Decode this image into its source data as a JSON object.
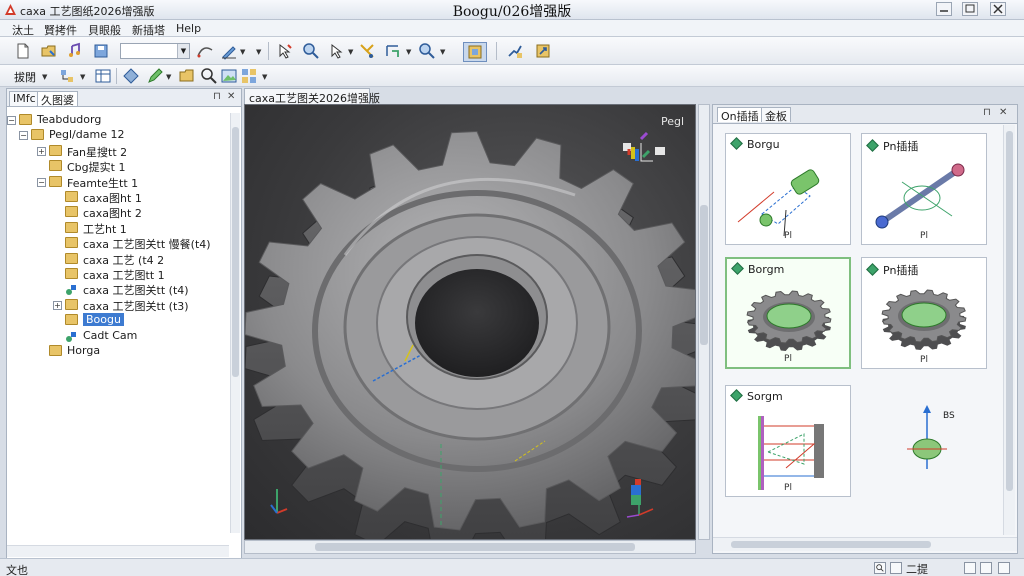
{
  "window": {
    "app_title": "caxa 工艺图纸2026增强版",
    "title": "Boogu/026增强版"
  },
  "menu": [
    "汰土",
    "賢拷件",
    "貝眼般",
    "新插塔",
    "Help"
  ],
  "toolbar2": {
    "mode_label": "拔閉"
  },
  "left_panel": {
    "tabs": [
      "IMfc",
      "久图婆"
    ],
    "tree": [
      {
        "label": "Teabdudorg",
        "level": 0,
        "type": "folder",
        "expander": "−"
      },
      {
        "label": "Pegl/dame 12",
        "level": 1,
        "type": "folder",
        "expander": "⊟"
      },
      {
        "label": "Fan星搜tt 2",
        "level": 2,
        "type": "folder",
        "expander": "⊞"
      },
      {
        "label": "Cbg提实t 1",
        "level": 2,
        "type": "folder",
        "expander": ""
      },
      {
        "label": "Feamte生tt 1",
        "level": 2,
        "type": "folder",
        "expander": "⊟"
      },
      {
        "label": "caxa图ht 1",
        "level": 3,
        "type": "folder",
        "expander": ""
      },
      {
        "label": "caxa图ht 2",
        "level": 3,
        "type": "folder",
        "expander": ""
      },
      {
        "label": "工艺ht 1",
        "level": 3,
        "type": "folder",
        "expander": ""
      },
      {
        "label": "caxa 工艺图关tt 慢餐(t4)",
        "level": 3,
        "type": "folder",
        "expander": ""
      },
      {
        "label": "caxa 工艺 (t4 2",
        "level": 3,
        "type": "folder",
        "expander": ""
      },
      {
        "label": "caxa 工艺图tt 1",
        "level": 3,
        "type": "folder",
        "expander": ""
      },
      {
        "label": "caxa 工艺图关tt (t4)",
        "level": 3,
        "type": "part",
        "expander": ""
      },
      {
        "label": "caxa 工艺图关tt (t3)",
        "level": 3,
        "type": "folder",
        "expander": "⊞"
      },
      {
        "label": "Boogu",
        "level": 3,
        "type": "folder",
        "expander": "",
        "selected": true
      },
      {
        "label": "Cadt Cam",
        "level": 3,
        "type": "part",
        "expander": ""
      },
      {
        "label": "Horga",
        "level": 2,
        "type": "folder",
        "expander": ""
      }
    ]
  },
  "viewport": {
    "tab": "caxa工艺图关2026增强版",
    "label": "Pegl"
  },
  "right_panel": {
    "tabs": [
      "On插插",
      "金板"
    ],
    "cards": [
      {
        "title": "Borgu",
        "caption": "Pl",
        "kind": "pin-green"
      },
      {
        "title": "Pn插插",
        "caption": "Pl",
        "kind": "shaft-blue"
      },
      {
        "title": "Borgm",
        "caption": "Pl",
        "kind": "gear",
        "selected": true
      },
      {
        "title": "Pn插插",
        "caption": "Pl",
        "kind": "gear"
      },
      {
        "title": "Sorgm",
        "caption": "Pl",
        "kind": "diagram"
      },
      {
        "title": "",
        "caption": "",
        "kind": "axis-dot",
        "annotation": "BS"
      }
    ]
  },
  "status": {
    "text": "文也",
    "zoom_label": "二提"
  },
  "colors": {
    "accent": "#3d7bd1",
    "gear": "#8c8c8e",
    "viewport_bg": "#3a3a3c",
    "selected_card": "#7fbf7f"
  }
}
